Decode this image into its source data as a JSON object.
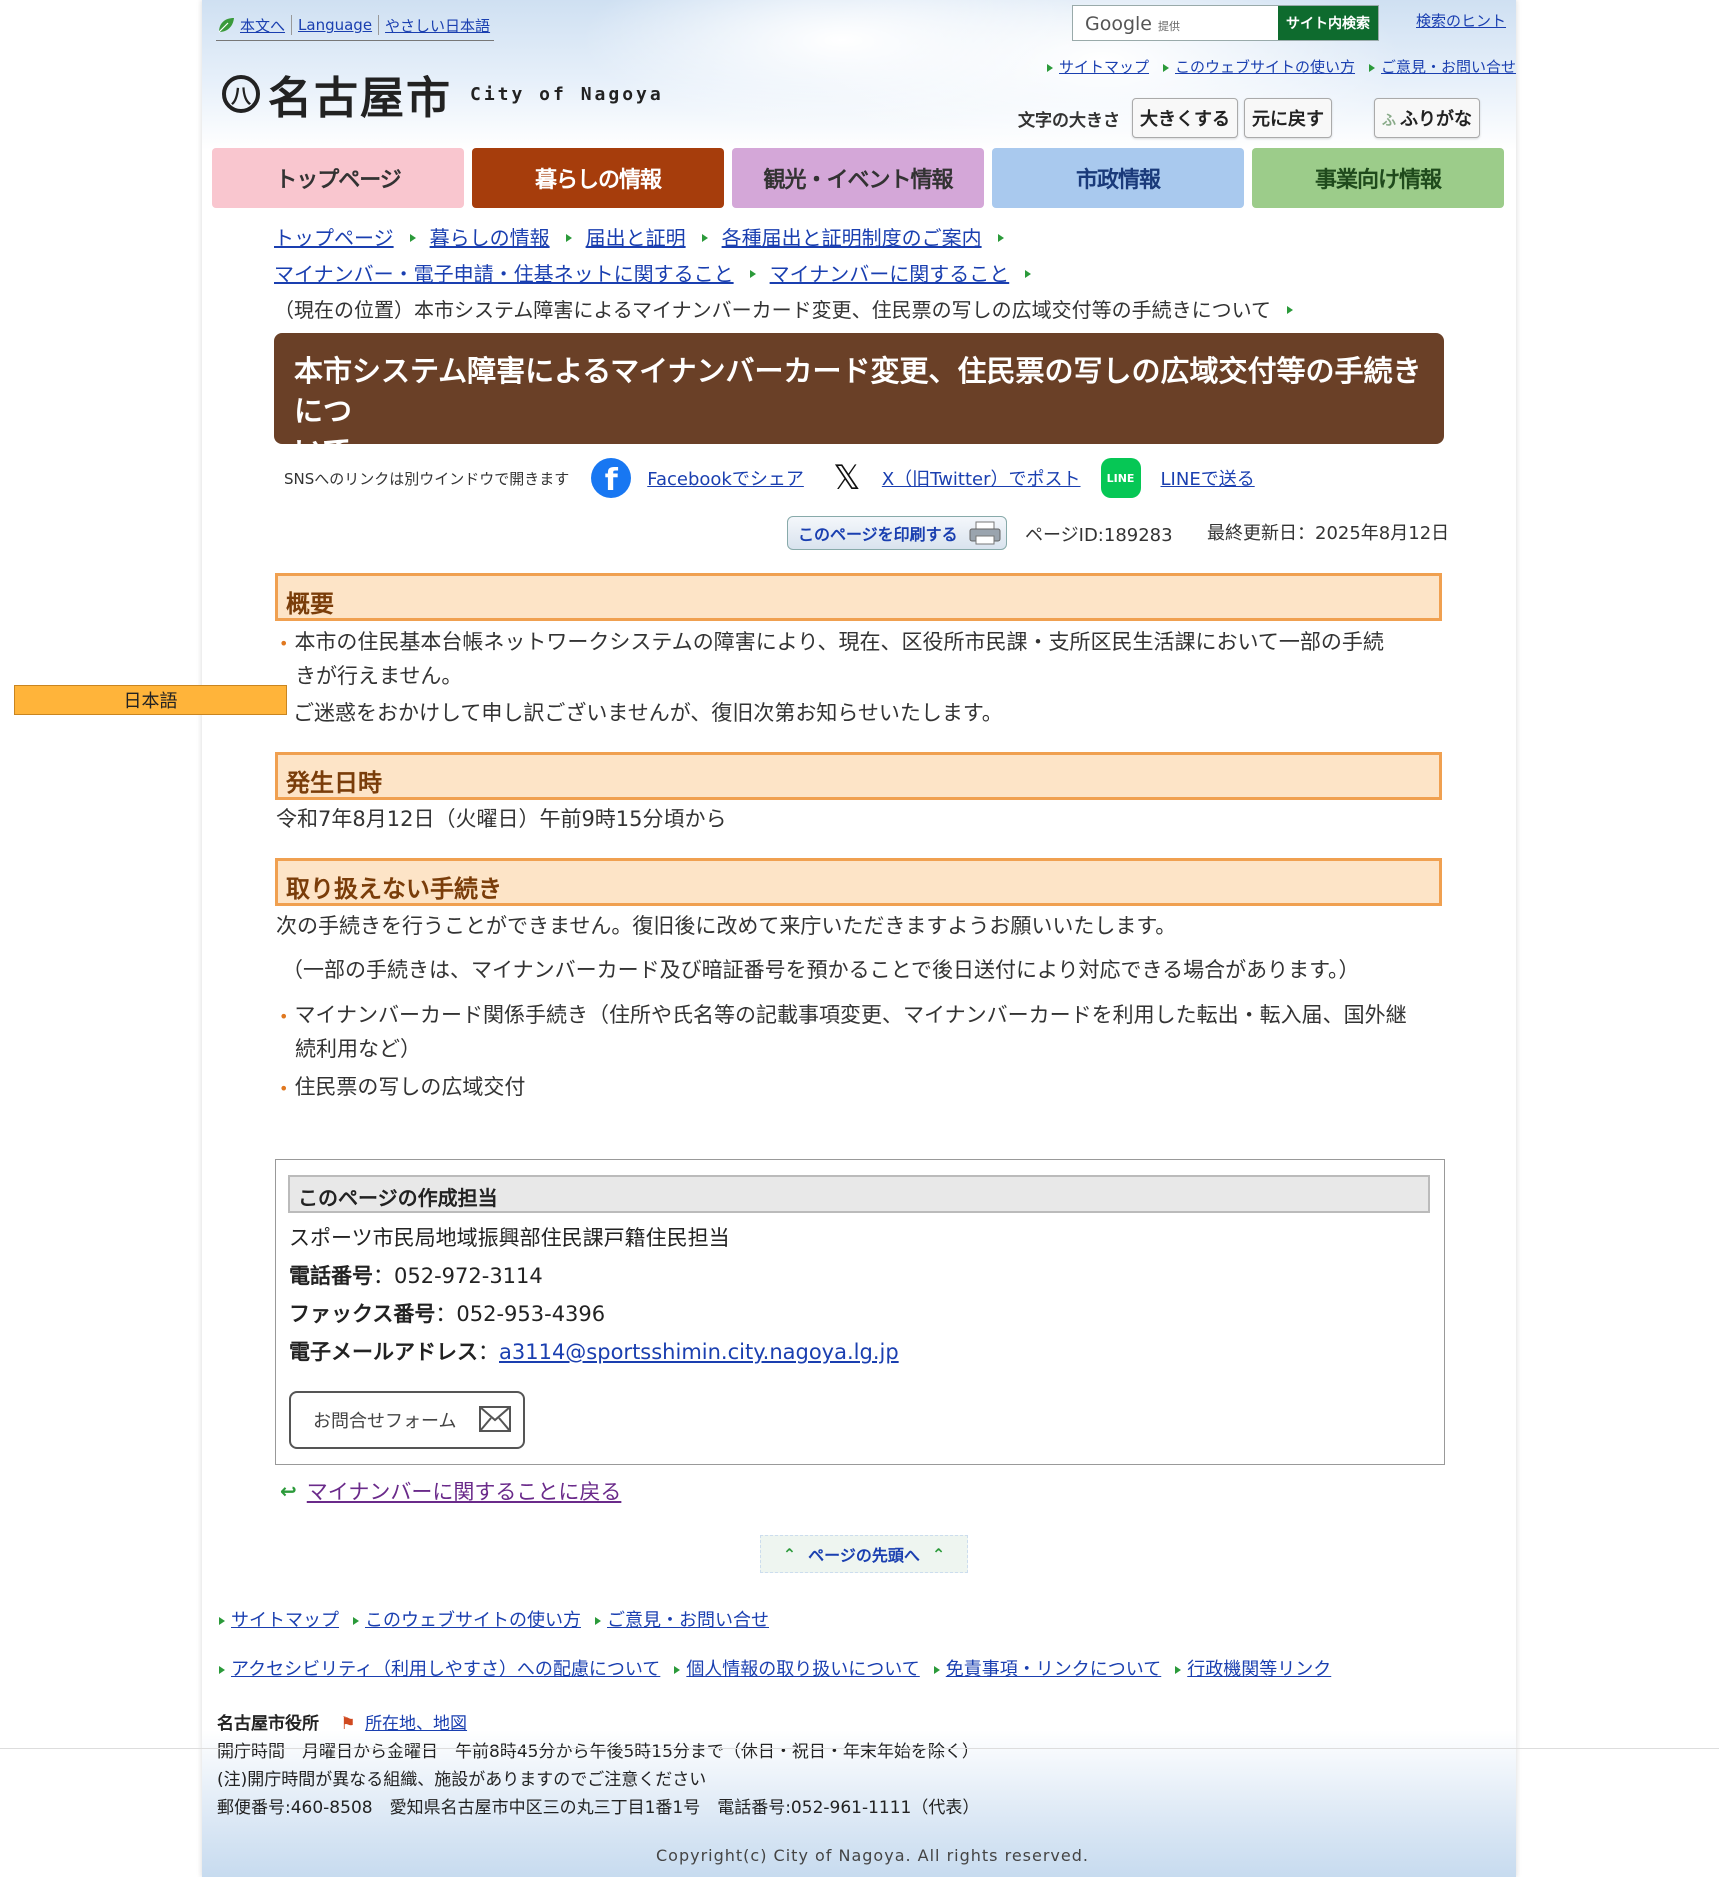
{
  "top": {
    "skip_link": "本文へ",
    "language": "Language",
    "easy_japanese": "やさしい日本語",
    "search_brand": "Google",
    "search_powered": "提供",
    "search_button": "サイト内検索",
    "search_hint": "検索のヒント"
  },
  "logo": {
    "mark": "八",
    "jp": "名古屋市",
    "en": "City of Nagoya"
  },
  "util_links": [
    "サイトマップ",
    "このウェブサイトの使い方",
    "ご意見・お問い合せ"
  ],
  "font_size": {
    "label": "文字の大きさ",
    "bigger": "大きくする",
    "reset": "元に戻す",
    "furigana": "ふりがな"
  },
  "main_nav": [
    {
      "label": "トップページ",
      "bg": "#f9c6cf",
      "fg": "#333333"
    },
    {
      "label": "暮らしの情報",
      "bg": "#a63d0c",
      "fg": "#ffffff"
    },
    {
      "label": "観光・イベント情報",
      "bg": "#d4a7d8",
      "fg": "#333333"
    },
    {
      "label": "市政情報",
      "bg": "#a9c9ee",
      "fg": "#1a3a7a"
    },
    {
      "label": "事業向け情報",
      "bg": "#9ccc8a",
      "fg": "#1f4a1c"
    }
  ],
  "breadcrumb": {
    "row1": [
      "トップページ",
      "暮らしの情報",
      "届出と証明",
      "各種届出と証明制度のご案内"
    ],
    "row2": [
      "マイナンバー・電子申請・住基ネットに関すること",
      "マイナンバーに関すること"
    ],
    "current": "（現在の位置）本市システム障害によるマイナンバーカード変更、住民票の写しの広域交付等の手続きについて"
  },
  "page_title_line1": "本市システム障害によるマイナンバーカード変更、住民票の写しの広域交付等の手続きにつ",
  "page_title_line2": "いて",
  "sns": {
    "note": "SNSへのリンクは別ウインドウで開きます",
    "facebook": "Facebookでシェア",
    "x": "X（旧Twitter）でポスト",
    "line": "LINEで送る",
    "line_icon": "LINE"
  },
  "print_label": "このページを印刷する",
  "page_id": "ページID:189283",
  "updated": "最終更新日：2025年8月12日",
  "lang_button": "日本語",
  "sections": {
    "overview": {
      "heading": "概要",
      "bullet1_line1": "本市の住民基本台帳ネットワークシステムの障害により、現在、区役所市民課・支所区民生活課において一部の手続",
      "bullet1_line2": "きが行えません。",
      "text": "ご迷惑をおかけして申し訳ございませんが、復旧次第お知らせいたします。"
    },
    "occurred": {
      "heading": "発生日時",
      "text": "令和7年8月12日（火曜日）午前9時15分頃から"
    },
    "unavailable": {
      "heading": "取り扱えない手続き",
      "text1": "次の手続きを行うことができません。復旧後に改めて来庁いただきますようお願いいたします。",
      "text2": "（一部の手続きは、マイナンバーカード及び暗証番号を預かることで後日送付により対応できる場合があります。）",
      "bullet1_line1": "マイナンバーカード関係手続き（住所や氏名等の記載事項変更、マイナンバーカードを利用した転出・転入届、国外継",
      "bullet1_line2": "続利用など）",
      "bullet2": "住民票の写しの広域交付"
    }
  },
  "contact": {
    "heading": "このページの作成担当",
    "dept": "スポーツ市民局地域振興部住民課戸籍住民担当",
    "tel_label": "電話番号",
    "tel": "：052-972-3114",
    "fax_label": "ファックス番号",
    "fax": "：052-953-4396",
    "mail_label": "電子メールアドレス",
    "mail_sep": "：",
    "mail": "a3114@sportsshimin.city.nagoya.lg.jp",
    "form_button": "お問合せフォーム"
  },
  "back_link": "マイナンバーに関することに戻る",
  "to_top": "ページの先頭へ",
  "footer_links1": [
    "サイトマップ",
    "このウェブサイトの使い方",
    "ご意見・お問い合せ"
  ],
  "footer_links2": [
    "アクセシビリティ（利用しやすさ）への配慮について",
    "個人情報の取り扱いについて",
    "免責事項・リンクについて",
    "行政機関等リンク"
  ],
  "footer": {
    "office": "名古屋市役所",
    "map_link": "所在地、地図",
    "hours": "開庁時間　月曜日から金曜日　午前8時45分から午後5時15分まで（休日・祝日・年末年始を除く）",
    "note": "(注)開庁時間が異なる組織、施設がありますのでご注意ください",
    "address": "郵便番号:460-8508　愛知県名古屋市中区三の丸三丁目1番1号　電話番号:052-961-1111（代表）",
    "copyright": "Copyright(c) City of Nagoya. All rights reserved."
  }
}
